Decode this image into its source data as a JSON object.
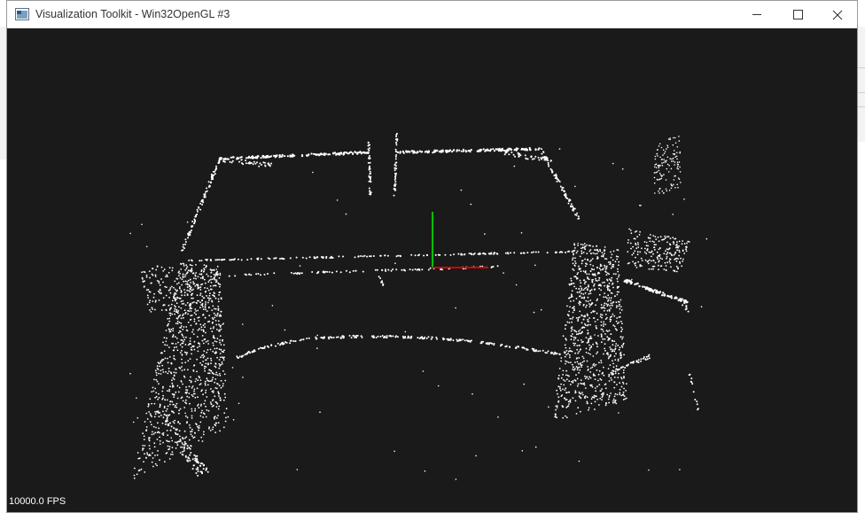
{
  "window": {
    "title": "Visualization Toolkit - Win32OpenGL #3",
    "icon": "vtk-app-icon",
    "controls": [
      "minimize-icon",
      "maximize-icon",
      "close-icon"
    ]
  },
  "viewport": {
    "background": "#1a1a1a",
    "point_color": "#ffffff",
    "axes": {
      "x_color": "#d40000",
      "y_color": "#00c000"
    }
  },
  "status": {
    "fps_text": "10000.0 FPS"
  }
}
